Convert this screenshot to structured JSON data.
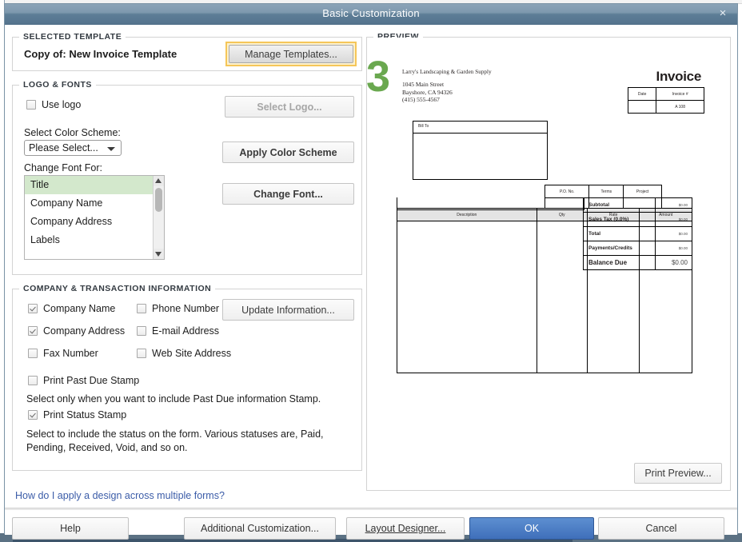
{
  "window": {
    "title": "Basic Customization",
    "close_icon": "×"
  },
  "selected_template": {
    "group_title": "SELECTED TEMPLATE",
    "name": "Copy of: New Invoice Template",
    "manage_templates_label": "Manage Templates..."
  },
  "logo_fonts": {
    "group_title": "LOGO & FONTS",
    "use_logo_label": "Use logo",
    "use_logo_checked": false,
    "select_logo_label": "Select Logo...",
    "select_color_scheme_label": "Select Color Scheme:",
    "color_scheme_value": "Please Select...",
    "apply_color_scheme_label": "Apply Color Scheme",
    "change_font_for_label": "Change Font For:",
    "font_items": [
      {
        "label": "Title",
        "selected": true
      },
      {
        "label": "Company Name",
        "selected": false
      },
      {
        "label": "Company Address",
        "selected": false
      },
      {
        "label": "Labels",
        "selected": false
      }
    ],
    "change_font_label": "Change Font..."
  },
  "company_info": {
    "group_title": "COMPANY & TRANSACTION INFORMATION",
    "checkboxes": [
      {
        "label": "Company Name",
        "checked": true
      },
      {
        "label": "Phone Number",
        "checked": false
      },
      {
        "label": "Company Address",
        "checked": true
      },
      {
        "label": "E-mail Address",
        "checked": false
      },
      {
        "label": "Fax Number",
        "checked": false
      },
      {
        "label": "Web Site Address",
        "checked": false
      }
    ],
    "past_due_label": "Print Past Due Stamp",
    "past_due_checked": false,
    "past_due_help": "Select only when you want to include Past Due information Stamp.",
    "status_stamp_label": "Print Status Stamp",
    "status_stamp_checked": true,
    "status_stamp_help": "Select to include the status on the form. Various statuses are, Paid, Pending, Received, Void, and so on.",
    "update_information_label": "Update Information..."
  },
  "help_link": "How do I apply a design across multiple forms?",
  "preview": {
    "group_title": "PREVIEW",
    "step_badge": "3",
    "print_preview_label": "Print Preview..."
  },
  "invoice": {
    "company_name": "Larry's Landscaping & Garden Supply",
    "address_line1": "1045 Main Street",
    "address_line2": "Bayshore, CA 94326",
    "phone": "(415) 555-4567",
    "title": "Invoice",
    "date_headers": [
      "Date",
      "Invoice #"
    ],
    "date_values": [
      "",
      "A 108"
    ],
    "bill_to_label": "Bill To",
    "meta_headers": [
      "P.O. No.",
      "Terms",
      "Project"
    ],
    "meta_values": [
      "",
      "",
      ""
    ],
    "line_headers": [
      "Description",
      "Qty",
      "Rate",
      "Amount"
    ],
    "totals": [
      {
        "label": "Subtotal",
        "amount": "$0.00"
      },
      {
        "label": "Sales Tax  (0.0%)",
        "amount": "$0.00"
      },
      {
        "label": "Total",
        "amount": "$0.00"
      },
      {
        "label": "Payments/Credits",
        "amount": "$0.00"
      },
      {
        "label": "Balance Due",
        "amount": "$0.00"
      }
    ]
  },
  "footer": {
    "help_label": "Help",
    "additional_customization_label": "Additional Customization...",
    "layout_designer_label": "Layout Designer...",
    "ok_label": "OK",
    "cancel_label": "Cancel"
  },
  "colors": {
    "title_bar": "#6b8aa3",
    "highlight_yellow": "#f5c659",
    "list_selection_green": "#d3e8cc",
    "step_badge_green": "#6aa84f",
    "link_blue": "#3b5ca8",
    "ok_blue": "#3f6fba"
  }
}
